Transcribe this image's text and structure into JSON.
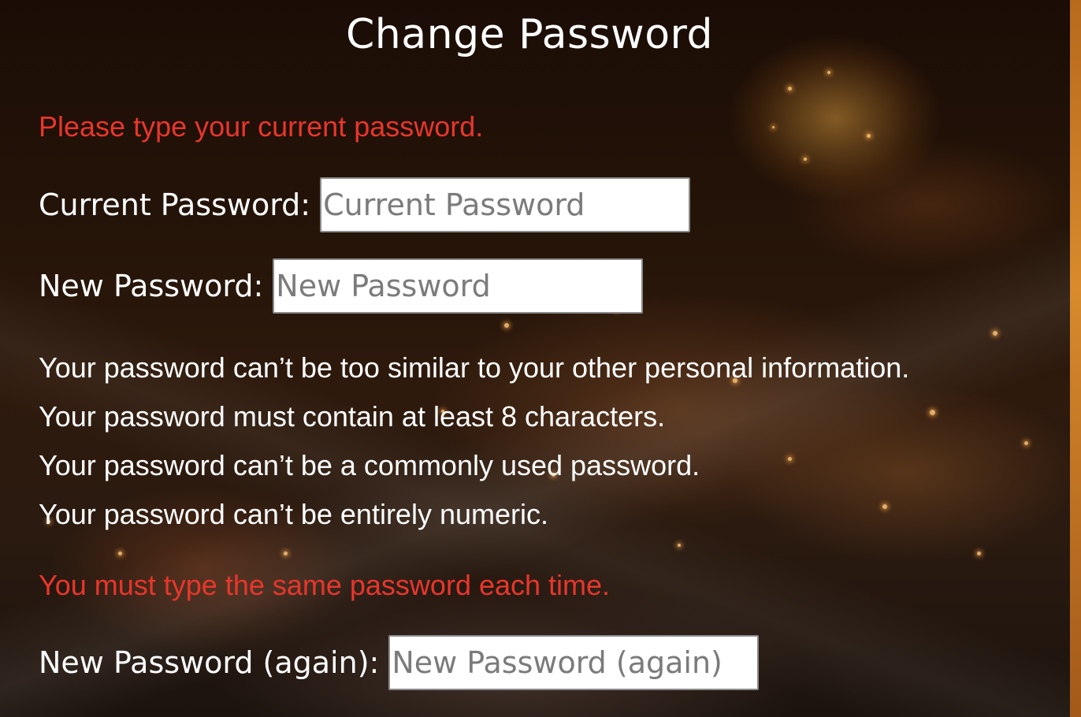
{
  "page": {
    "title": "Change Password"
  },
  "form": {
    "current_password": {
      "error": "Please type your current password.",
      "label": "Current Password:",
      "placeholder": "Current Password",
      "value": ""
    },
    "new_password": {
      "label": "New Password:",
      "placeholder": "New Password",
      "value": "",
      "help": [
        "Your password can’t be too similar to your other personal information.",
        "Your password must contain at least 8 characters.",
        "Your password can’t be a commonly used password.",
        "Your password can’t be entirely numeric."
      ]
    },
    "new_password_again": {
      "error": "You must type the same password each time.",
      "label": "New Password (again):",
      "placeholder": "New Password (again)",
      "value": ""
    }
  },
  "colors": {
    "error": "#e8362c",
    "text": "#ffffff",
    "input_bg": "#ffffff",
    "placeholder": "#7b7b7b",
    "edge_accent": "#d88a2c"
  }
}
